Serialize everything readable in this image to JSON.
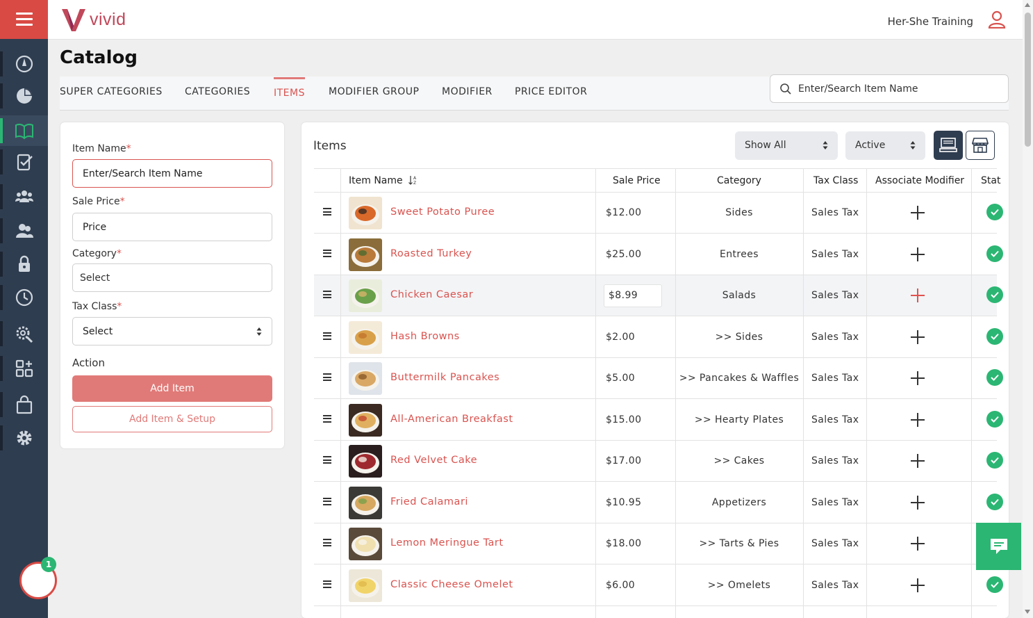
{
  "brand": {
    "name": "vivid",
    "accent": "#d9534f",
    "sidebar_bg": "#2f3d50",
    "success": "#2bb673"
  },
  "header": {
    "user_name": "Her-She Training"
  },
  "page": {
    "title": "Catalog"
  },
  "tabs": [
    {
      "label": "SUPER CATEGORIES",
      "active": false
    },
    {
      "label": "CATEGORIES",
      "active": false
    },
    {
      "label": "ITEMS",
      "active": true
    },
    {
      "label": "MODIFIER GROUP",
      "active": false
    },
    {
      "label": "MODIFIER",
      "active": false
    },
    {
      "label": "PRICE EDITOR",
      "active": false
    }
  ],
  "search": {
    "placeholder": "Enter/Search Item Name",
    "icon": "search-icon"
  },
  "sidebar": {
    "items": [
      {
        "icon": "dashboard-gauge-icon",
        "active": false
      },
      {
        "icon": "pie-chart-icon",
        "active": false
      },
      {
        "icon": "book-open-icon",
        "active": true
      },
      {
        "icon": "clipboard-check-icon",
        "active": false
      },
      {
        "icon": "users-group-icon",
        "active": false
      },
      {
        "icon": "users-icon",
        "active": false
      },
      {
        "icon": "lock-icon",
        "active": false
      },
      {
        "icon": "clock-icon",
        "active": false
      },
      {
        "icon": "settings-search-icon",
        "active": false
      },
      {
        "icon": "apps-plus-icon",
        "active": false
      },
      {
        "icon": "shopping-bag-icon",
        "active": false
      },
      {
        "icon": "gear-icon",
        "active": false
      }
    ],
    "notification_count": "1"
  },
  "form": {
    "item_name": {
      "label": "Item Name",
      "placeholder": "Enter/Search Item Name"
    },
    "sale_price": {
      "label": "Sale Price",
      "placeholder": "Price"
    },
    "category": {
      "label": "Category",
      "placeholder": "Select"
    },
    "tax_class": {
      "label": "Tax Class",
      "value": "Select"
    },
    "action": {
      "label": "Action",
      "add_item": "Add Item",
      "add_item_setup": "Add Item & Setup"
    }
  },
  "items_panel": {
    "title": "Items",
    "filter_show": "Show All",
    "filter_status": "Active",
    "columns": [
      "Item Name",
      "Sale Price",
      "Category",
      "Tax Class",
      "Associate Modifier",
      "Stat"
    ],
    "rows": [
      {
        "name": "Sweet Potato Puree",
        "price": "$12.00",
        "category": "Sides",
        "tax": "Sales Tax",
        "thumb": [
          "#f0e4d0",
          "#d9692b",
          "#3a2a22"
        ]
      },
      {
        "name": "Roasted Turkey",
        "price": "$25.00",
        "category": "Entrees",
        "tax": "Sales Tax",
        "thumb": [
          "#8a6d3b",
          "#b97a3a",
          "#4b6a2f"
        ]
      },
      {
        "name": "Chicken Caesar",
        "price": "$8.99",
        "category": "Salads",
        "tax": "Sales Tax",
        "thumb": [
          "#e9eddc",
          "#6aa04a",
          "#d7b46a"
        ],
        "hover": true
      },
      {
        "name": "Hash Browns",
        "price": "$2.00",
        "category": ">> Sides",
        "tax": "Sales Tax",
        "thumb": [
          "#f4ead8",
          "#d9a04a",
          "#c2762c"
        ]
      },
      {
        "name": "Buttermilk Pancakes",
        "price": "$5.00",
        "category": ">> Pancakes & Waffles",
        "tax": "Sales Tax",
        "thumb": [
          "#dfe4ea",
          "#d9a865",
          "#8a5a2b"
        ]
      },
      {
        "name": "All-American Breakfast",
        "price": "$15.00",
        "category": ">> Hearty Plates",
        "tax": "Sales Tax",
        "thumb": [
          "#3a2a22",
          "#e0b060",
          "#c4492f"
        ]
      },
      {
        "name": "Red Velvet Cake",
        "price": "$17.00",
        "category": ">> Cakes",
        "tax": "Sales Tax",
        "thumb": [
          "#2a1e1e",
          "#9e2a2f",
          "#f1e8e0"
        ]
      },
      {
        "name": "Fried Calamari",
        "price": "$10.95",
        "category": "Appetizers",
        "tax": "Sales Tax",
        "thumb": [
          "#3b3a36",
          "#d6a860",
          "#7aa04a"
        ]
      },
      {
        "name": "Lemon Meringue Tart",
        "price": "$18.00",
        "category": ">> Tarts & Pies",
        "tax": "Sales Tax",
        "thumb": [
          "#5a4a3a",
          "#f0e0b0",
          "#f7f3ea"
        ]
      },
      {
        "name": "Classic Cheese Omelet",
        "price": "$6.00",
        "category": ">> Omelets",
        "tax": "Sales Tax",
        "thumb": [
          "#ece7d8",
          "#f1d469",
          "#e0b84a"
        ]
      }
    ]
  }
}
